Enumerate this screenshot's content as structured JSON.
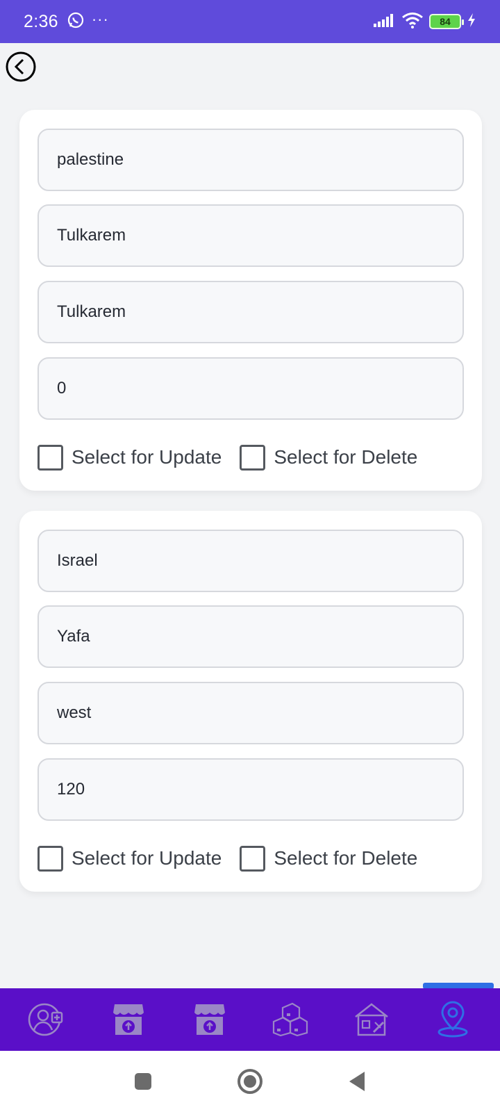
{
  "status_bar": {
    "time": "2:36",
    "battery_level": "84",
    "icons": [
      "whatsapp-icon",
      "more-dots-icon",
      "signal-icon",
      "wifi-icon",
      "battery-icon",
      "charging-icon"
    ]
  },
  "entries": [
    {
      "country": "palestine",
      "city": "Tulkarem",
      "area": "Tulkarem",
      "price": "0",
      "update_label": "Select for Update",
      "delete_label": "Select for Delete"
    },
    {
      "country": "Israel",
      "city": "Yafa",
      "area": "west",
      "price": "120",
      "update_label": "Select for Update",
      "delete_label": "Select for Delete"
    }
  ],
  "bottom_nav": {
    "active_index": 5,
    "items": [
      "add-user-icon",
      "store-upload-icon",
      "store-upload-icon",
      "boxes-icon",
      "warehouse-icon",
      "location-pin-icon"
    ],
    "colors": {
      "background": "#5a0fc8",
      "inactive": "#9a86c6",
      "active": "#2f6fe5"
    }
  },
  "colors": {
    "status_bar": "#5f4bdb",
    "page_background": "#f2f3f5",
    "card": "#ffffff"
  }
}
